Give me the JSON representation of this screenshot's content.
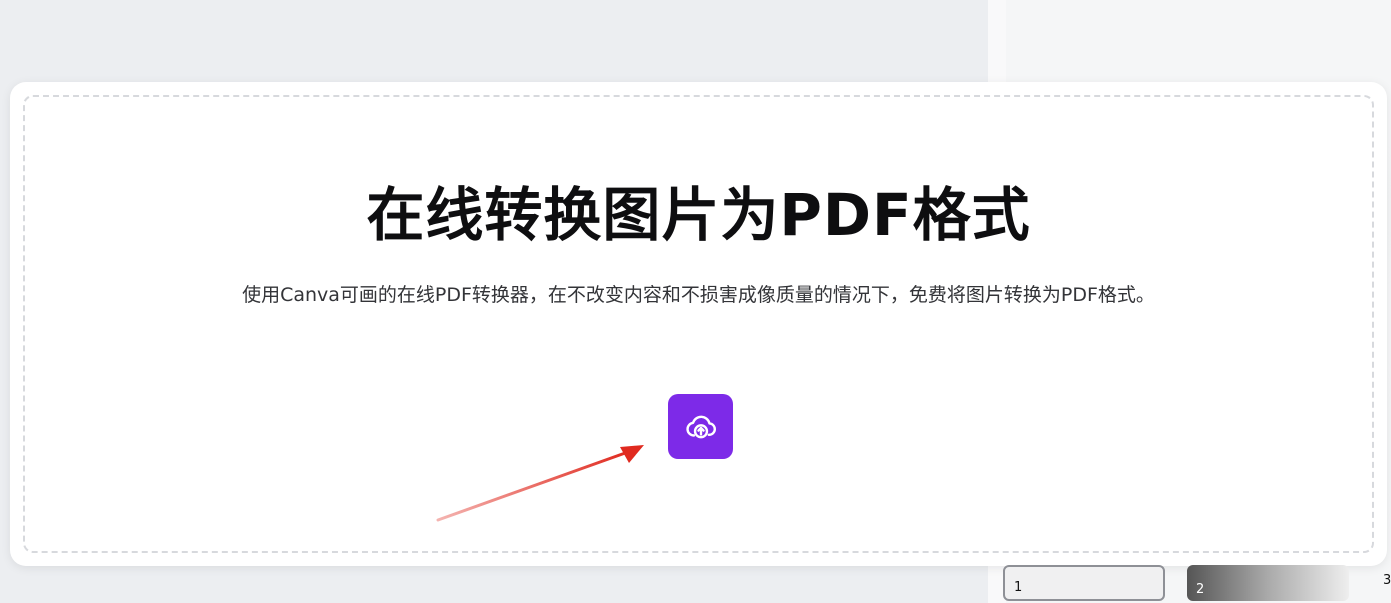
{
  "hero": {
    "title": "在线转换图片为PDF格式",
    "subtitle": "使用Canva可画的在线PDF转换器，在不改变内容和不损害成像质量的情况下，免费将图片转换为PDF格式。"
  },
  "upload": {
    "icon": "cloud-upload-icon",
    "color": "#7d2ae8"
  },
  "annotation": {
    "arrow_color": "#e02a1f"
  },
  "thumbnails": {
    "pages": [
      "1",
      "2",
      "3"
    ]
  }
}
